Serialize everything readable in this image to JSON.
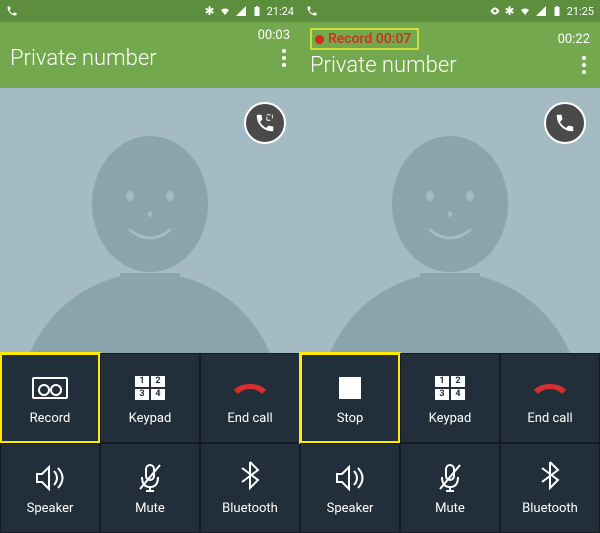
{
  "screens": [
    {
      "status": {
        "time": "21:24"
      },
      "header": {
        "call_time": "00:03",
        "caller_name": "Private number",
        "recording": false,
        "record_label": null
      },
      "buttons": {
        "record": "Record",
        "keypad": "Keypad",
        "endcall": "End call",
        "speaker": "Speaker",
        "mute": "Mute",
        "bluetooth": "Bluetooth"
      },
      "highlight": "record"
    },
    {
      "status": {
        "time": "21:25"
      },
      "header": {
        "call_time": "00:22",
        "caller_name": "Private number",
        "recording": true,
        "record_label": "Record  00:07"
      },
      "buttons": {
        "stop": "Stop",
        "keypad": "Keypad",
        "endcall": "End call",
        "speaker": "Speaker",
        "mute": "Mute",
        "bluetooth": "Bluetooth"
      },
      "highlight": "stop"
    }
  ],
  "keypad_digits": [
    "1",
    "2",
    "3",
    "4"
  ]
}
